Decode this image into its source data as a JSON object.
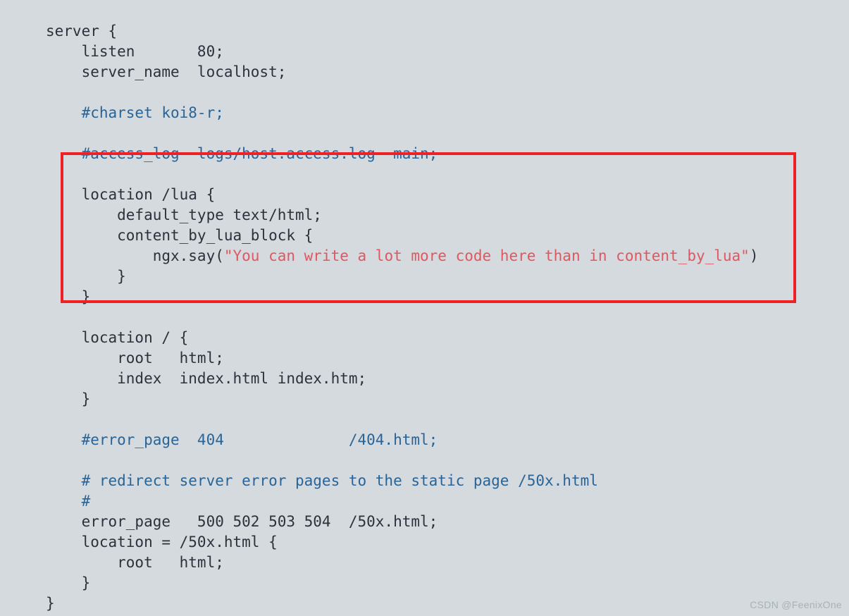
{
  "editor": {
    "background_color": "#d4dade",
    "text_color": "#2c313c",
    "comment_color": "#2a6496",
    "string_color": "#e2565f",
    "highlight_color": "#ec2227",
    "language": "nginx-conf",
    "lines": [
      {
        "indent": 0,
        "tokens": [
          {
            "t": "plain",
            "s": "server {"
          }
        ]
      },
      {
        "indent": 4,
        "tokens": [
          {
            "t": "plain",
            "s": "listen       80;"
          }
        ]
      },
      {
        "indent": 4,
        "tokens": [
          {
            "t": "plain",
            "s": "server_name  localhost;"
          }
        ]
      },
      {
        "indent": 0,
        "tokens": [
          {
            "t": "plain",
            "s": ""
          }
        ]
      },
      {
        "indent": 4,
        "tokens": [
          {
            "t": "comment",
            "s": "#charset koi8-r;"
          }
        ]
      },
      {
        "indent": 0,
        "tokens": [
          {
            "t": "plain",
            "s": ""
          }
        ]
      },
      {
        "indent": 4,
        "tokens": [
          {
            "t": "comment",
            "s": "#access_log  logs/host.access.log  main;"
          }
        ]
      },
      {
        "indent": 0,
        "tokens": [
          {
            "t": "plain",
            "s": ""
          }
        ]
      },
      {
        "indent": 4,
        "tokens": [
          {
            "t": "plain",
            "s": "location /lua {"
          }
        ]
      },
      {
        "indent": 8,
        "tokens": [
          {
            "t": "plain",
            "s": "default_type text/html;"
          }
        ]
      },
      {
        "indent": 8,
        "tokens": [
          {
            "t": "plain",
            "s": "content_by_lua_block {"
          }
        ]
      },
      {
        "indent": 12,
        "tokens": [
          {
            "t": "plain",
            "s": "ngx.say("
          },
          {
            "t": "string",
            "s": "\"You can write a lot more code here than in content_by_lua\""
          },
          {
            "t": "plain",
            "s": ")"
          }
        ]
      },
      {
        "indent": 8,
        "tokens": [
          {
            "t": "plain",
            "s": "}"
          }
        ]
      },
      {
        "indent": 4,
        "tokens": [
          {
            "t": "plain",
            "s": "}"
          }
        ]
      },
      {
        "indent": 0,
        "tokens": [
          {
            "t": "plain",
            "s": ""
          }
        ]
      },
      {
        "indent": 4,
        "tokens": [
          {
            "t": "plain",
            "s": "location / {"
          }
        ]
      },
      {
        "indent": 8,
        "tokens": [
          {
            "t": "plain",
            "s": "root   html;"
          }
        ]
      },
      {
        "indent": 8,
        "tokens": [
          {
            "t": "plain",
            "s": "index  index.html index.htm;"
          }
        ]
      },
      {
        "indent": 4,
        "tokens": [
          {
            "t": "plain",
            "s": "}"
          }
        ]
      },
      {
        "indent": 0,
        "tokens": [
          {
            "t": "plain",
            "s": ""
          }
        ]
      },
      {
        "indent": 4,
        "tokens": [
          {
            "t": "comment",
            "s": "#error_page  404              /404.html;"
          }
        ]
      },
      {
        "indent": 0,
        "tokens": [
          {
            "t": "plain",
            "s": ""
          }
        ]
      },
      {
        "indent": 4,
        "tokens": [
          {
            "t": "comment",
            "s": "# redirect server error pages to the static page /50x.html"
          }
        ]
      },
      {
        "indent": 4,
        "tokens": [
          {
            "t": "comment",
            "s": "#"
          }
        ]
      },
      {
        "indent": 4,
        "tokens": [
          {
            "t": "plain",
            "s": "error_page   500 502 503 504  /50x.html;"
          }
        ]
      },
      {
        "indent": 4,
        "tokens": [
          {
            "t": "plain",
            "s": "location = /50x.html {"
          }
        ]
      },
      {
        "indent": 8,
        "tokens": [
          {
            "t": "plain",
            "s": "root   html;"
          }
        ]
      },
      {
        "indent": 4,
        "tokens": [
          {
            "t": "plain",
            "s": "}"
          }
        ]
      },
      {
        "indent": 0,
        "tokens": [
          {
            "t": "plain",
            "s": "}"
          }
        ]
      }
    ]
  },
  "highlight": {
    "label": "red-highlight-rectangle",
    "color": "#ec2227",
    "covers_lines": "location /lua { ... }"
  },
  "watermark": {
    "text": "CSDN @FeenixOne"
  }
}
